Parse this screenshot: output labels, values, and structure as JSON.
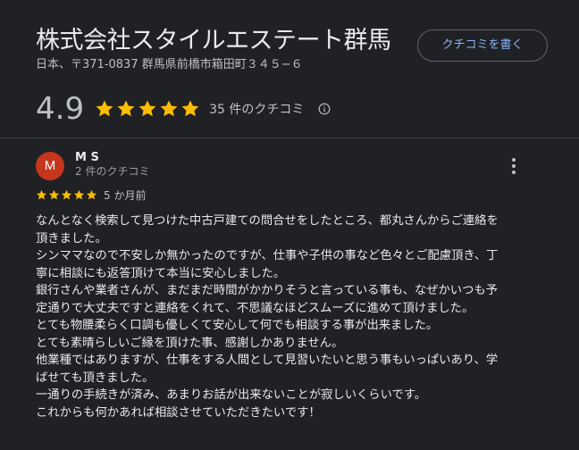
{
  "business": {
    "title": "株式会社スタイルエステート群馬",
    "address": "日本、〒371-0837 群馬県前橋市箱田町３４５−６",
    "write_review_label": "クチコミを書く"
  },
  "summary": {
    "rating": "4.9",
    "stars": 5,
    "review_count": "35 件のクチコミ"
  },
  "colors": {
    "star": "#fbbc04",
    "avatar": "#c5361d",
    "link": "#8ab4f8"
  },
  "icons": {
    "info": "info-icon",
    "more": "more-vert-icon",
    "star": "star-icon"
  },
  "review": {
    "avatar_letter": "M",
    "reviewer_name": "M S",
    "reviewer_meta": "2 件のクチコミ",
    "stars": 5,
    "date": "5 か月前",
    "lines": [
      "なんとなく検索して見つけた中古戸建ての問合せをしたところ、都丸さんからご連絡を",
      "頂きました。",
      "シンママなので不安しか無かったのですが、仕事や子供の事など色々とご配慮頂き、丁",
      "寧に相談にも返答頂けて本当に安心しました。",
      "銀行さんや業者さんが、まだまだ時間がかかりそうと言っている事も、なぜかいつも予",
      "定通りで大丈夫ですと連絡をくれて、不思議なほどスムーズに進めて頂けました。",
      "とても物腰柔らく口調も優しくて安心して何でも相談する事が出来ました。",
      "とても素晴らしいご縁を頂けた事、感謝しかありません。",
      "他業種ではありますが、仕事をする人間として見習いたいと思う事もいっぱいあり、学",
      "ばせても頂きました。",
      "一通りの手続きが済み、あまりお話が出来ないことが寂しいくらいです。",
      "これからも何かあれば相談させていただきたいです！"
    ]
  }
}
